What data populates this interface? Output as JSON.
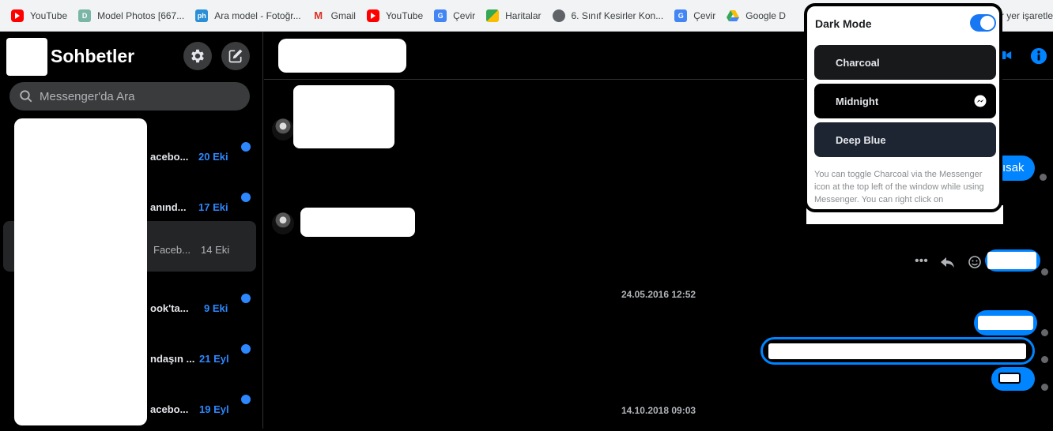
{
  "bookmarks": [
    {
      "label": "YouTube",
      "icon": "youtube-icon"
    },
    {
      "label": "Model Photos [667...",
      "icon": "d-icon"
    },
    {
      "label": "Ara model - Fotoğr...",
      "icon": "ph-icon"
    },
    {
      "label": "Gmail",
      "icon": "gmail-icon"
    },
    {
      "label": "YouTube",
      "icon": "youtube-icon"
    },
    {
      "label": "Çevir",
      "icon": "translate-icon"
    },
    {
      "label": "Haritalar",
      "icon": "maps-icon"
    },
    {
      "label": "6. Sınıf Kesirler Kon...",
      "icon": "globe-icon"
    },
    {
      "label": "Çevir",
      "icon": "translate-icon"
    },
    {
      "label": "Google D",
      "icon": "drive-icon"
    }
  ],
  "bookmarks_tail": "r yer işaretle",
  "sidebar": {
    "title": "Sohbetler",
    "search_placeholder": "Messenger'da Ara",
    "conversations": [
      {
        "snippet": "acebo...",
        "date": "20 Eki",
        "unread": true
      },
      {
        "snippet": "anınd...",
        "date": "17 Eki",
        "unread": true
      },
      {
        "snippet": "Faceb...",
        "date": "14 Eki",
        "unread": false
      },
      {
        "snippet": "ook'ta...",
        "date": "9 Eki",
        "unread": true
      },
      {
        "snippet": "ndaşın ...",
        "date": "21 Eyl",
        "unread": true
      },
      {
        "snippet": "acebo...",
        "date": "19 Eyl",
        "unread": true
      }
    ]
  },
  "chat": {
    "timestamps": [
      "24.05.2016 12:52",
      "14.10.2018 09:03"
    ],
    "partial_message": "ısak"
  },
  "dark_mode": {
    "title": "Dark Mode",
    "enabled": true,
    "themes": [
      {
        "label": "Charcoal"
      },
      {
        "label": "Midnight"
      },
      {
        "label": "Deep Blue"
      }
    ],
    "description": "You can toggle Charcoal via the Messenger icon at the top left of the window while using Messenger. You can right click on"
  },
  "colors": {
    "accent": "#0084ff",
    "unread": "#2d88ff",
    "toggle": "#1877f2"
  }
}
